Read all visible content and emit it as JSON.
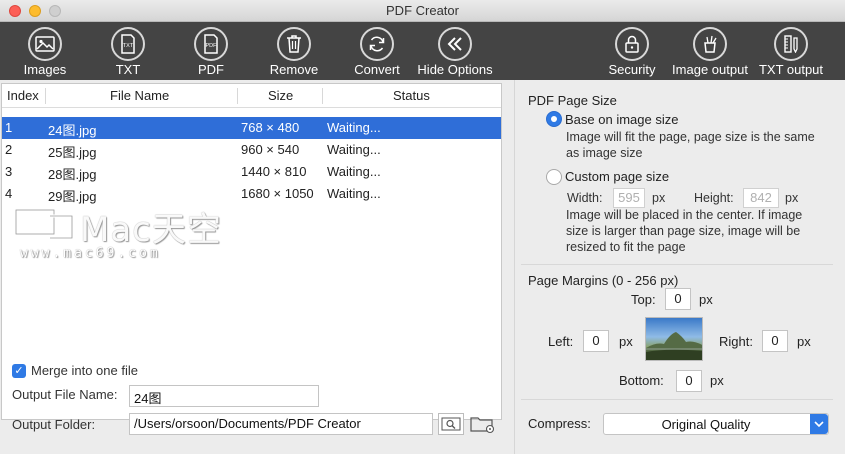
{
  "window": {
    "title": "PDF Creator"
  },
  "toolbar": {
    "images": {
      "label": "Images"
    },
    "txt": {
      "label": "TXT"
    },
    "pdf": {
      "label": "PDF"
    },
    "remove": {
      "label": "Remove"
    },
    "convert": {
      "label": "Convert"
    },
    "hide_options": {
      "label": "Hide Options"
    },
    "security": {
      "label": "Security"
    },
    "image_output": {
      "label": "Image output"
    },
    "txt_output": {
      "label": "TXT output"
    }
  },
  "file_table": {
    "columns": {
      "index": "Index",
      "file_name": "File Name",
      "size": "Size",
      "status": "Status"
    },
    "rows": [
      {
        "index": "1",
        "file_name": "24图.jpg",
        "size": "768 × 480",
        "status": "Waiting...",
        "selected": true
      },
      {
        "index": "2",
        "file_name": "25图.jpg",
        "size": "960 × 540",
        "status": "Waiting...",
        "selected": false
      },
      {
        "index": "3",
        "file_name": "28图.jpg",
        "size": "1440 × 810",
        "status": "Waiting...",
        "selected": false
      },
      {
        "index": "4",
        "file_name": "29图.jpg",
        "size": "1680 × 1050",
        "status": "Waiting...",
        "selected": false
      }
    ]
  },
  "watermark": {
    "brand": "Mac天空",
    "url": "www.mac69.com"
  },
  "output": {
    "merge_label": "Merge into one file",
    "merge_checked": true,
    "file_name_label": "Output File Name:",
    "file_name_value": "24图",
    "folder_label": "Output Folder:",
    "folder_value": "/Users/orsoon/Documents/PDF Creator",
    "search_icon": "magnifier-icon",
    "folder_icon": "folder-settings-icon"
  },
  "page_size": {
    "heading": "PDF Page Size",
    "base_option": "Base on image size",
    "base_desc_1": "Image will fit the page, page size is the same",
    "base_desc_2": "as image size",
    "custom_option": "Custom page size",
    "width_label": "Width:",
    "width_value": "595",
    "height_label": "Height:",
    "height_value": "842",
    "unit": "px",
    "custom_desc_1": "Image will be placed in the center. If image",
    "custom_desc_2": "size is larger than page size, image will be",
    "custom_desc_3": "resized to fit the page",
    "selected": "base"
  },
  "margins": {
    "heading": "Page Margins (0 - 256 px)",
    "top_label": "Top:",
    "top_value": "0",
    "left_label": "Left:",
    "left_value": "0",
    "right_label": "Right:",
    "right_value": "0",
    "bottom_label": "Bottom:",
    "bottom_value": "0",
    "unit": "px"
  },
  "compress": {
    "label": "Compress:",
    "value": "Original Quality"
  },
  "colors": {
    "toolbar_bg": "#444444",
    "selection": "#2f6ed8",
    "accent": "#2f7ae5"
  }
}
